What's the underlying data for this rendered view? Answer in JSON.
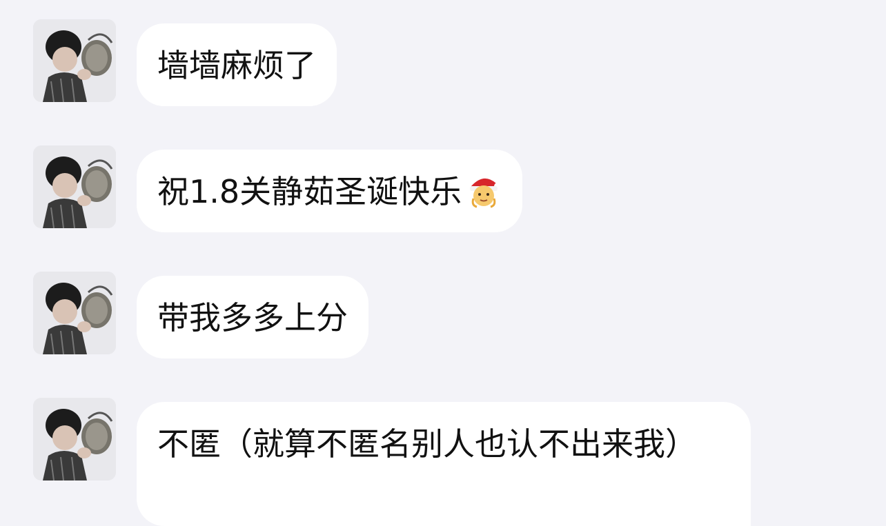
{
  "colors": {
    "background": "#f3f3f8",
    "bubble": "#ffffff",
    "text": "#111111"
  },
  "messages": [
    {
      "text": "墙墙麻烦了",
      "emoji": null
    },
    {
      "text": "祝1.8关静茹圣诞快乐",
      "emoji": "santa-face-emoji"
    },
    {
      "text": "带我多多上分",
      "emoji": null
    },
    {
      "text": "不匿（就算不匿名别人也认不出来我）",
      "emoji": null
    }
  ]
}
